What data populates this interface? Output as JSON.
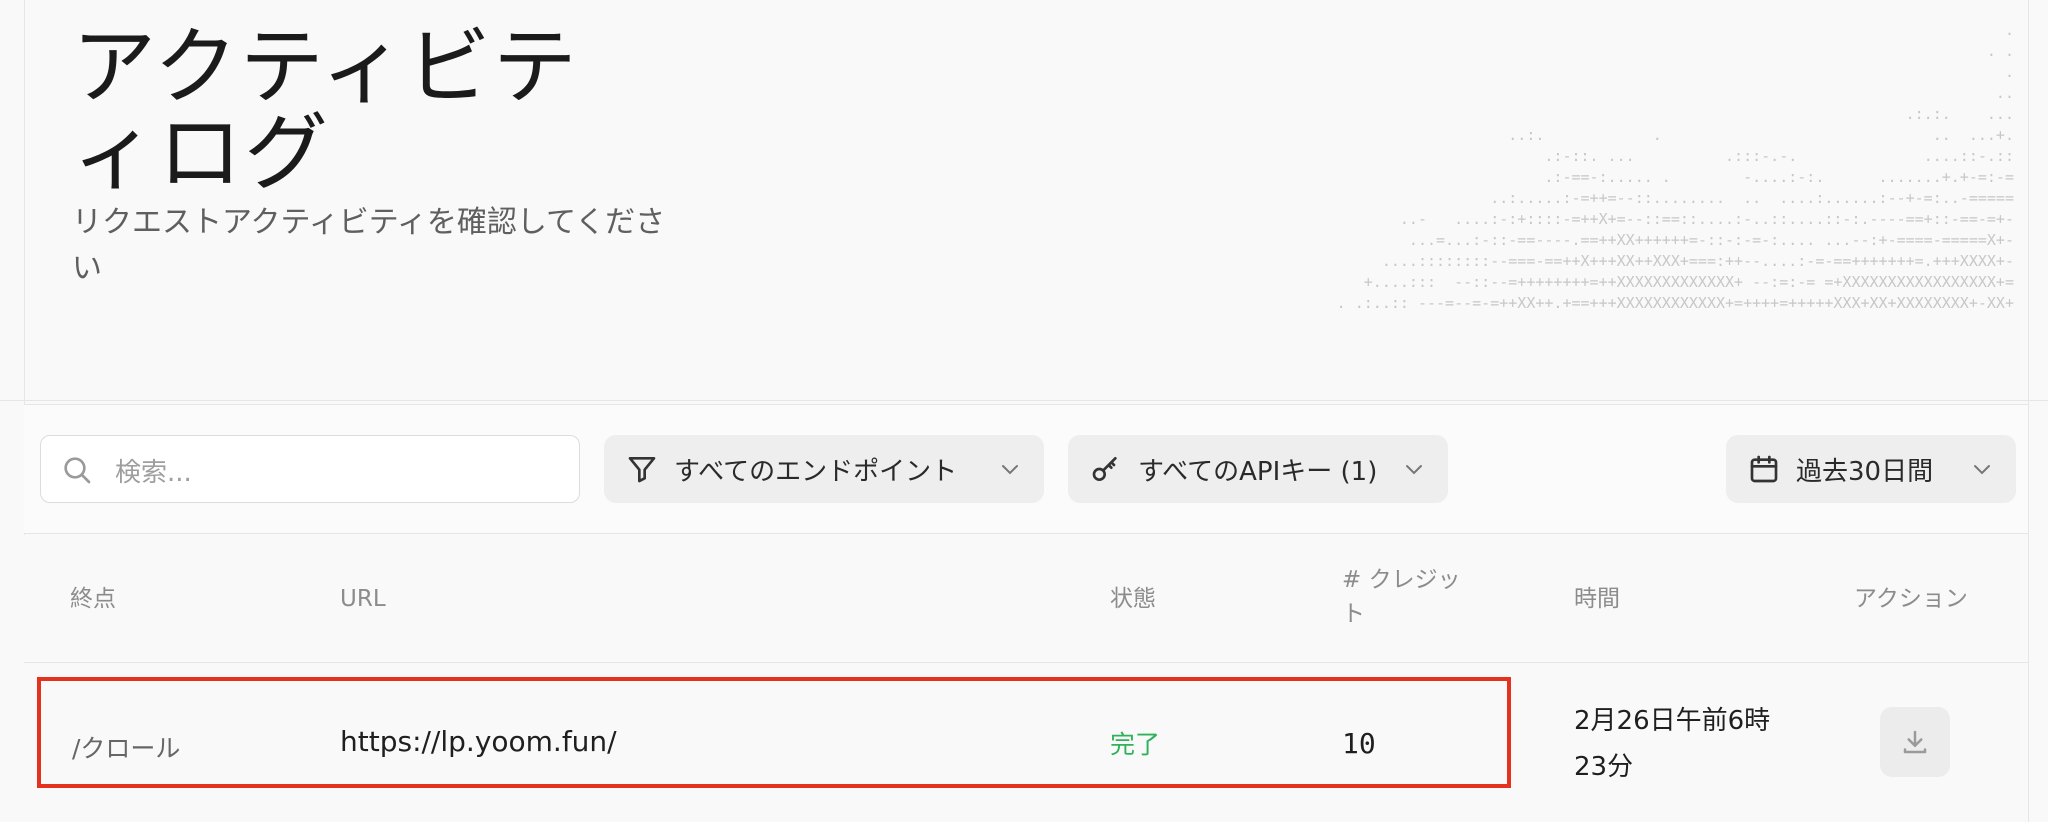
{
  "header": {
    "title": "アクティビティログ",
    "subtitle": "リクエストアクティビティを確認してください",
    "ascii_art": "                                                                                 .\n                                                                              . .\n                                                                                .\n                                                                              ..\n                                                                     .:.:.    ...\n                      ..:.            .                              ..  ...+.\n                     .:-::. ...          .:::-.-.              ....::-.::\n                    .:-==-:..... .        -....:-:.      .......+.+-=:-=\n                 ..:.....:-=++=--::........  ..  ....:......:--+-=:..-=====\n            ..-   ....:-:+::::-=++X+=--::==::....:-..::....::-:.----==+::-==-=+-\n          ...=...:-::-==----.==++XX++++++=-::-:-=-:.... ...--:+-====-=====X+-\n        ....::::::::--===-==++X+++XX++XXX+===:++--....:-=-==+++++++=.+++XXXX+-\n       +....:::  --::--=++++++++=++XXXXXXXXXXXXX+ --:=:-= =+XXXXXXXXXXXXXXXXX+=\n     . .:..:: ---=--=-=++XX++.+==+++XXXXXXXXXXXX+=++++=+++++XXX+XX+XXXXXXXX+-XX+"
  },
  "filters": {
    "search_placeholder": "検索...",
    "endpoint_label": "すべてのエンドポイント",
    "apikey_label": "すべてのAPIキー (1)",
    "date_label": "過去30日間"
  },
  "table": {
    "headers": {
      "endpoint": "終点",
      "url": "URL",
      "status": "状態",
      "credits": "# クレジット",
      "time": "時間",
      "action": "アクション"
    },
    "rows": [
      {
        "endpoint": "/クロール",
        "url": "https://lp.yoom.fun/",
        "status": "完了",
        "credits": "10",
        "time": "2月26日午前6時23分"
      }
    ]
  },
  "colors": {
    "status_complete": "#2fb35a",
    "highlight_border": "#e4321f"
  }
}
